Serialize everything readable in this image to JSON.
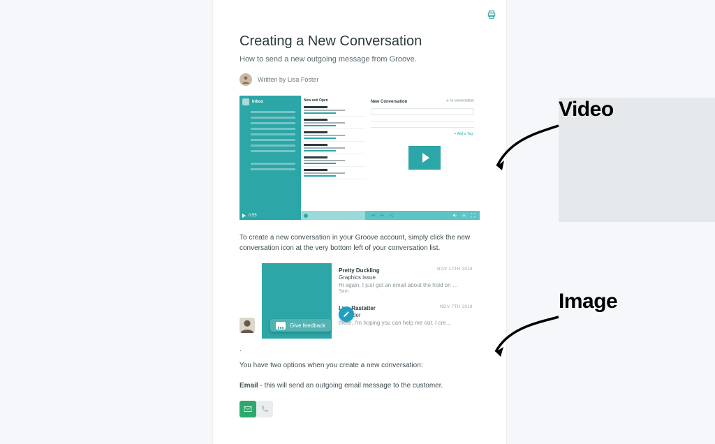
{
  "article": {
    "title": "Creating a New Conversation",
    "subtitle": "How to send a new outgoing message from Groove.",
    "byline": "Written by Lisa Foster",
    "para1": "To create a new conversation in your Groove account, simply click the new conversation icon at the very bottom left of your conversation list.",
    "dot": ".",
    "para2": "You have two options when you create a new conversation:",
    "para3_strong": "Email",
    "para3_rest": " - this will send an outgoing email message to the customer."
  },
  "video_ui": {
    "sidebar_title": "Inbox",
    "list_header": "New and Open",
    "main_title": "New Conversation",
    "corner": "to conversation",
    "tag": "+ Add a Tag",
    "timestamp": "0:55"
  },
  "conversation_list": {
    "items": [
      {
        "name": "Pretty Duckling",
        "date": "NOV 12TH 2018",
        "subject": "Graphics issue",
        "body": "Hi again, I just got an email about the hold on …",
        "from": "Sam"
      },
      {
        "name": "Lisa Rastatter",
        "date": "NOV 7TH 2018",
        "subject": "ed Order",
        "body": "there, I'm hoping you can help me out. I cre…",
        "from": ""
      }
    ],
    "feedback_label": "Give feedback"
  },
  "annotations": {
    "video": "Video",
    "image": "Image"
  }
}
